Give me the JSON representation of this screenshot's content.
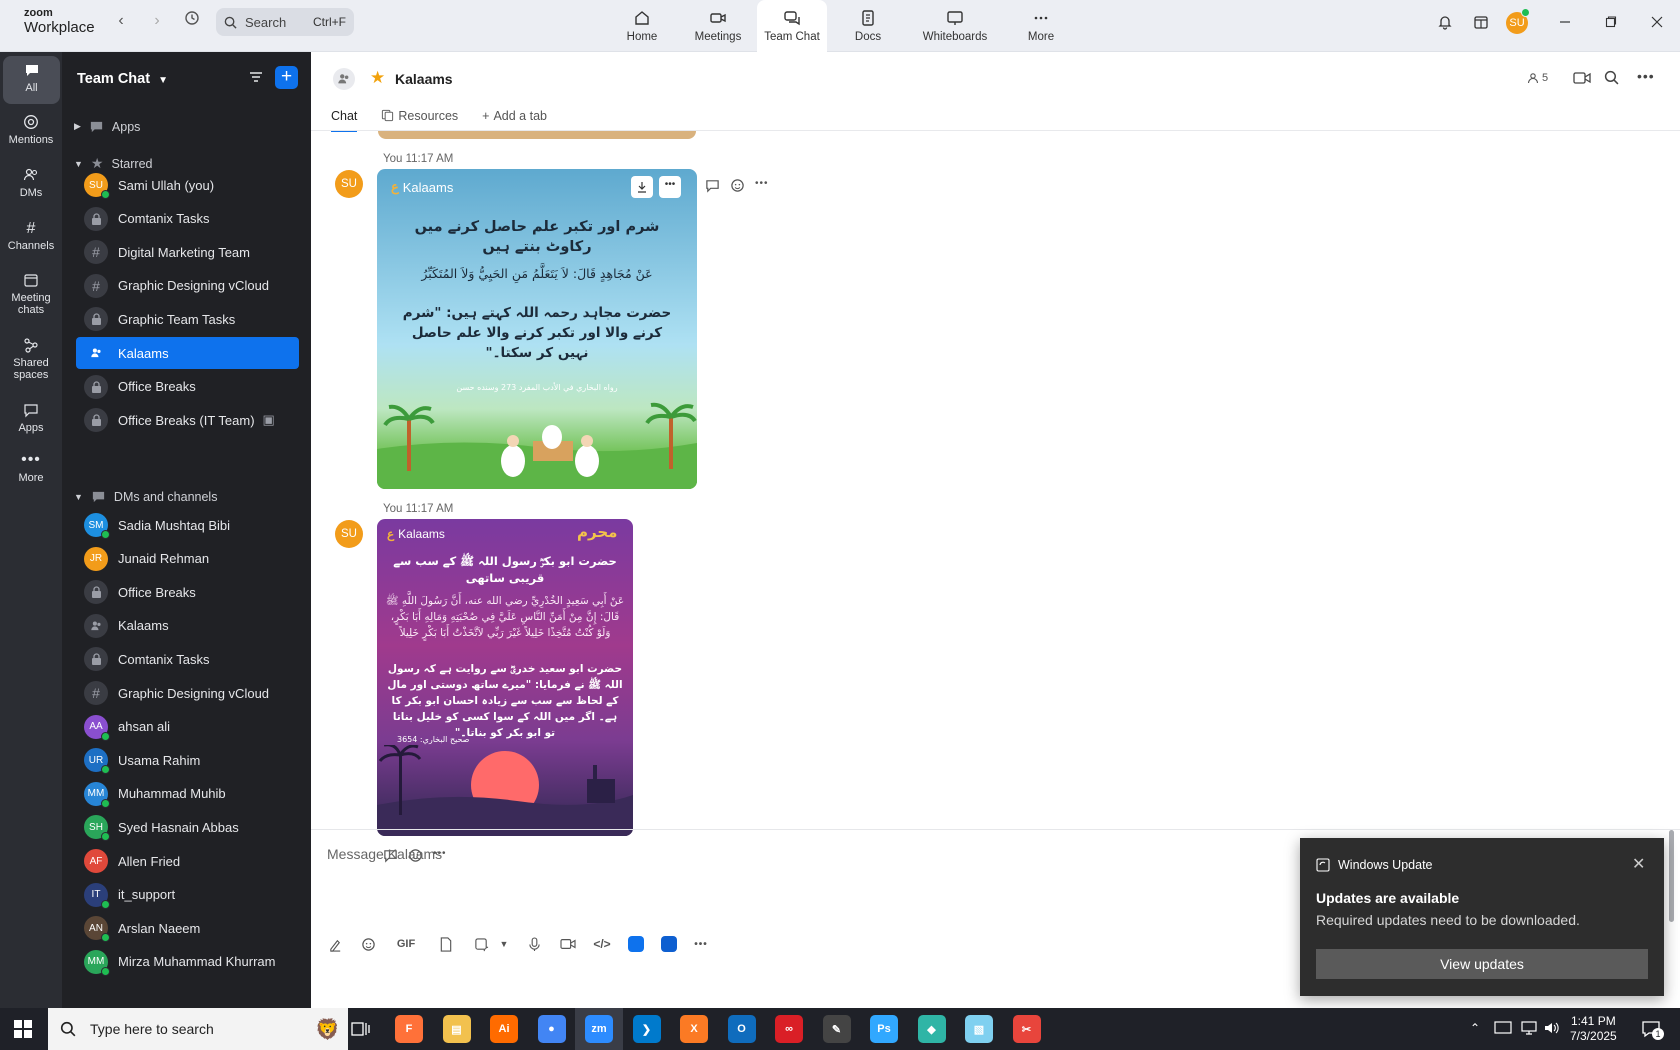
{
  "app": {
    "logo_line1": "zoom",
    "logo_line2": "Workplace"
  },
  "search": {
    "label": "Search",
    "shortcut": "Ctrl+F"
  },
  "top_tabs": [
    {
      "label": "Home",
      "icon": "home-icon"
    },
    {
      "label": "Meetings",
      "icon": "video-icon"
    },
    {
      "label": "Team Chat",
      "icon": "chat-icon"
    },
    {
      "label": "Docs",
      "icon": "doc-icon"
    },
    {
      "label": "Whiteboards",
      "icon": "whiteboard-icon"
    },
    {
      "label": "More",
      "icon": "more-icon"
    }
  ],
  "user": {
    "initials": "SU"
  },
  "rail": [
    {
      "label": "All"
    },
    {
      "label": "Mentions"
    },
    {
      "label": "DMs"
    },
    {
      "label": "Channels"
    },
    {
      "label": "Meeting chats"
    },
    {
      "label": "Shared spaces"
    },
    {
      "label": "Apps"
    },
    {
      "label": "More"
    }
  ],
  "sidebar": {
    "title": "Team Chat",
    "apps_label": "Apps",
    "starred_label": "Starred",
    "starred": [
      {
        "label": "Sami Ullah (you)",
        "type": "avatar",
        "initials": "SU",
        "color": "#f29c1a",
        "online": true
      },
      {
        "label": "Comtanix Tasks",
        "type": "lock"
      },
      {
        "label": "Digital Marketing Team",
        "type": "hash"
      },
      {
        "label": "Graphic Designing vCloud",
        "type": "hash"
      },
      {
        "label": "Graphic Team Tasks",
        "type": "lock"
      },
      {
        "label": "Kalaams",
        "type": "group",
        "active": true
      },
      {
        "label": "Office Breaks",
        "type": "lock"
      },
      {
        "label": "Office Breaks (IT Team)",
        "type": "lock"
      }
    ],
    "dms_label": "DMs and channels",
    "dms": [
      {
        "label": "Sadia Mushtaq Bibi",
        "type": "avatar",
        "initials": "SM",
        "color": "#1d8fe0",
        "online": true
      },
      {
        "label": "Junaid Rehman",
        "type": "avatar",
        "initials": "JR",
        "color": "#f29c1a",
        "online": false
      },
      {
        "label": "Office Breaks",
        "type": "lock"
      },
      {
        "label": "Kalaams",
        "type": "group"
      },
      {
        "label": "Comtanix Tasks",
        "type": "lock"
      },
      {
        "label": "Graphic Designing vCloud",
        "type": "hash"
      },
      {
        "label": "ahsan ali",
        "type": "avatar",
        "initials": "AA",
        "color": "#8a4fcf",
        "online": true
      },
      {
        "label": "Usama Rahim",
        "type": "avatar",
        "initials": "UR",
        "color": "#1d6fc4",
        "online": true
      },
      {
        "label": "Muhammad Muhib",
        "type": "avatar",
        "initials": "MM",
        "color": "#2785d6",
        "online": true
      },
      {
        "label": "Syed Hasnain Abbas",
        "type": "avatar",
        "initials": "SH",
        "color": "#2aa65a",
        "online": true
      },
      {
        "label": "Allen Fried",
        "type": "avatar",
        "initials": "AF",
        "color": "#e0493b",
        "online": false
      },
      {
        "label": "it_support",
        "type": "avatar",
        "initials": "IT",
        "color": "#2b3f7a",
        "online": true
      },
      {
        "label": "Arslan Naeem",
        "type": "avatar",
        "initials": "AN",
        "color": "#5a4636",
        "online": true
      },
      {
        "label": "Mirza Muhammad Khurram",
        "type": "avatar",
        "initials": "MM",
        "color": "#2aa65a",
        "online": true
      }
    ]
  },
  "channel": {
    "name": "Kalaams",
    "members": "5",
    "tabs": [
      "Chat",
      "Resources",
      "Add a tab"
    ]
  },
  "messages": [
    {
      "sender": "You",
      "time": "11:17 AM",
      "avatar": "SU",
      "brand": "Kalaams",
      "title_urdu": "شرم اور تکبر علم حاصل کرنے میں رکاوٹ بنتے ہیں",
      "arabic": "عَنْ مُجَاهِدٍ قَالَ: لاَ يَتَعَلَّمُ مَنِ الحَيِيُّ وَلاَ المُتَكَبِّرُ",
      "translation": "حضرت مجاہد رحمہ اللہ کہتے ہیں: \"شرم کرنے والا اور تکبر کرنے والا علم حاصل نہیں کر سکتا۔\"",
      "source": "رواه البخاري في الأدب المفرد 273 وسنده حسن"
    },
    {
      "sender": "You",
      "time": "11:17 AM",
      "avatar": "SU",
      "brand": "Kalaams",
      "badge": "محرم",
      "title_urdu": "حضرت ابو بکرؓ رسول اللہ ﷺ کے سب سے قریبی ساتھی",
      "arabic": "عَنْ أَبِي سَعِيدٍ الخُدْرِيِّ رضي الله عنه، أَنَّ رَسُولَ اللَّهِ ﷺ قَالَ: إِنَّ مِنْ أَمَنِّ النَّاسِ عَلَيَّ فِي صُحْبَتِهِ وَمَالِهِ أَبَا بَكْرٍ، وَلَوْ كُنْتُ مُتَّخِذًا خَلِيلاً غَيْرَ رَبِّي لاَتَّخَذْتُ أَبَا بَكْرٍ خَلِيلاً",
      "translation": "حضرت ابو سعید خدریؓ سے روایت ہے کہ رسول اللہ ﷺ نے فرمایا: \"میرے ساتھ دوستی اور مال کے لحاظ سے سب سے زیادہ احسان ابو بکر کا ہے۔ اگر میں اللہ کے سوا کسی کو خلیل بناتا تو ابو بکر کو بناتا۔\"",
      "source": "صحيح البخاري: 3654"
    }
  ],
  "composer": {
    "placeholder": "Message Kalaams",
    "gif_label": "GIF"
  },
  "toast": {
    "app": "Windows Update",
    "title": "Updates are available",
    "body": "Required updates need to be downloaded.",
    "button": "View updates"
  },
  "taskbar": {
    "search_placeholder": "Type here to search",
    "time": "1:41 PM",
    "date": "7/3/2025",
    "notifications": "1",
    "apps": [
      "Firefox",
      "File Explorer",
      "Illustrator",
      "Chrome",
      "Zoom",
      "VS Code",
      "XAMPP",
      "Outlook",
      "Creative Cloud",
      "Pen tool",
      "Photoshop",
      "App",
      "App",
      "Snipping tool"
    ]
  },
  "colors": {
    "accent": "#0e72ed",
    "sidebar_bg": "#202125",
    "rail_bg": "#2b2d33"
  }
}
